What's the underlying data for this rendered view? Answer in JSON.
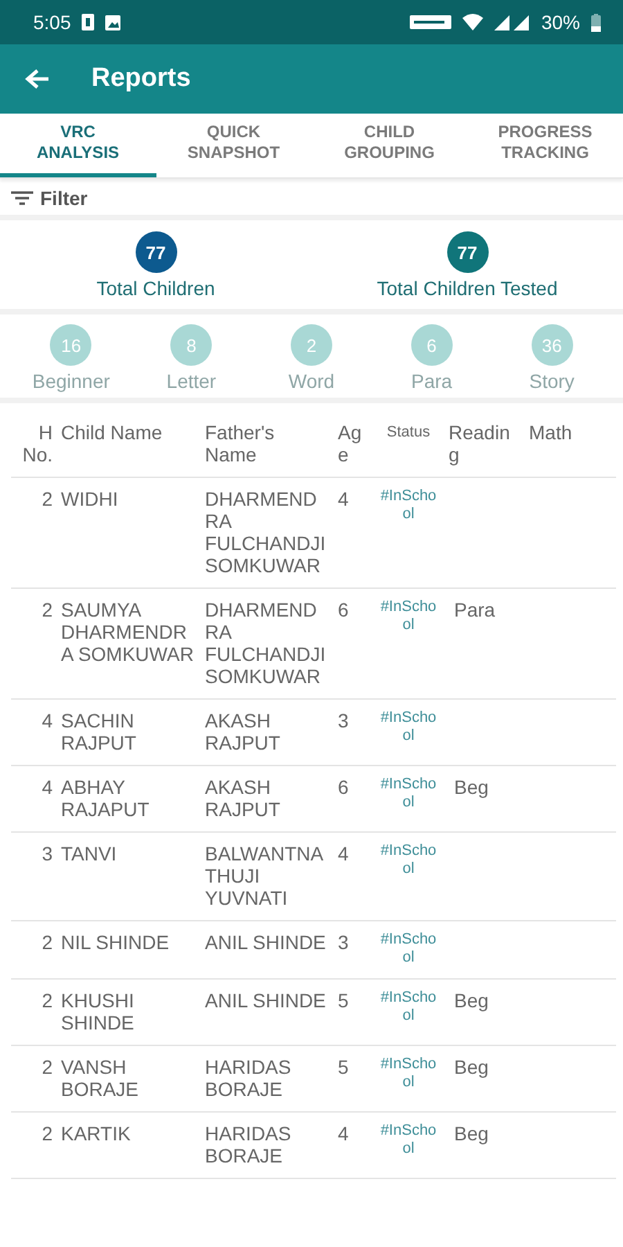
{
  "status_bar": {
    "time": "5:05",
    "battery": "30%"
  },
  "app_bar": {
    "title": "Reports"
  },
  "tabs": [
    {
      "label": "VRC ANALYSIS",
      "selected": true
    },
    {
      "label": "QUICK SNAPSHOT",
      "selected": false
    },
    {
      "label": "CHILD GROUPING",
      "selected": false
    },
    {
      "label": "PROGRESS TRACKING",
      "selected": false
    }
  ],
  "filter": {
    "label": "Filter"
  },
  "totals": [
    {
      "value": "77",
      "label": "Total Children",
      "color": "#0d5a8f"
    },
    {
      "value": "77",
      "label": "Total Children Tested",
      "color": "#10757a"
    }
  ],
  "levels": [
    {
      "count": "16",
      "label": "Beginner"
    },
    {
      "count": "8",
      "label": "Letter"
    },
    {
      "count": "2",
      "label": "Word"
    },
    {
      "count": "6",
      "label": "Para"
    },
    {
      "count": "36",
      "label": "Story"
    }
  ],
  "table": {
    "columns": [
      "H No.",
      "Child Name",
      "Father's Name",
      "Age",
      "Status",
      "Reading",
      "Math"
    ],
    "rows": [
      {
        "h_no": "2",
        "child_name": "WIDHI",
        "father_name": "DHARMENDRA FULCHANDJI SOMKUWAR",
        "age": "4",
        "status": "#InSchool"
      },
      {
        "h_no": "2",
        "child_name": "SAUMYA DHARMENDRA SOMKUWAR",
        "father_name": "DHARMENDRA FULCHANDJI SOMKUWAR",
        "age": "6",
        "status": "#InSchool",
        "reading": "Para"
      },
      {
        "h_no": "4",
        "child_name": "SACHIN RAJPUT",
        "father_name": "AKASH RAJPUT",
        "age": "3",
        "status": "#InSchool"
      },
      {
        "h_no": "4",
        "child_name": "ABHAY RAJAPUT",
        "father_name": "AKASH RAJPUT",
        "age": "6",
        "status": "#InSchool",
        "reading": "Beg"
      },
      {
        "h_no": "3",
        "child_name": "TANVI",
        "father_name": "BALWANTNATHUJI YUVNATI",
        "age": "4",
        "status": "#InSchool"
      },
      {
        "h_no": "2",
        "child_name": "NIL SHINDE",
        "father_name": "ANIL SHINDE",
        "age": "3",
        "status": "#InSchool"
      },
      {
        "h_no": "2",
        "child_name": "KHUSHI SHINDE",
        "father_name": "ANIL SHINDE",
        "age": "5",
        "status": "#InSchool",
        "reading": "Beg"
      },
      {
        "h_no": "2",
        "child_name": "VANSH BORAJE",
        "father_name": "HARIDAS BORAJE",
        "age": "5",
        "status": "#InSchool",
        "reading": "Beg"
      },
      {
        "h_no": "2",
        "child_name": "KARTIK",
        "father_name": "HARIDAS BORAJE",
        "age": "4",
        "status": "#InSchool",
        "reading": "Beg"
      }
    ]
  }
}
